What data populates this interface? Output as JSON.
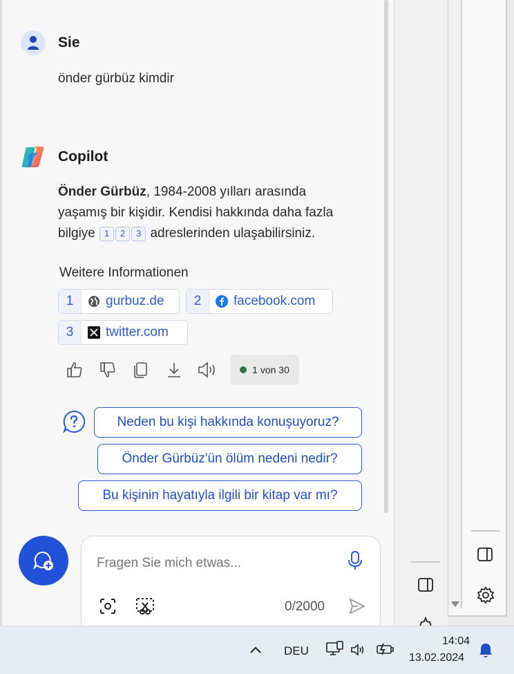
{
  "user_message": {
    "sender": "Sie",
    "text": "önder gürbüz kimdir"
  },
  "copilot_message": {
    "sender": "Copilot",
    "bold_name": "Önder Gürbüz",
    "text_part1": ", 1984-2008 yılları arasında",
    "text_line2": "yaşamış bir kişidir. Kendisi hakkında daha fazla",
    "text_line3_start": "bilgiye",
    "citations": [
      "1",
      "2",
      "3"
    ],
    "text_line3_end": "adreslerinden ulaşabilirsiniz."
  },
  "more_info": {
    "title": "Weitere Informationen",
    "sources": [
      {
        "num": "1",
        "icon": "globe-icon",
        "label": "gurbuz.de"
      },
      {
        "num": "2",
        "icon": "facebook-icon",
        "label": "facebook.com"
      },
      {
        "num": "3",
        "icon": "x-twitter-icon",
        "label": "twitter.com"
      }
    ]
  },
  "response_counter": "1 von 30",
  "suggestions": [
    "Neden bu kişi hakkında konuşuyoruz?",
    "Önder Gürbüz'ün ölüm nedeni nedir?",
    "Bu kişinin hayatıyla ilgili bir kitap var mı?"
  ],
  "composer": {
    "placeholder": "Fragen Sie mich etwas...",
    "char_count": "0/2000"
  },
  "taskbar": {
    "language": "DEU",
    "time": "14:04",
    "date": "13.02.2024"
  },
  "colors": {
    "accent": "#2b5bd7",
    "new_chat": "#2250d6",
    "status_dot": "#2c7a3a"
  }
}
